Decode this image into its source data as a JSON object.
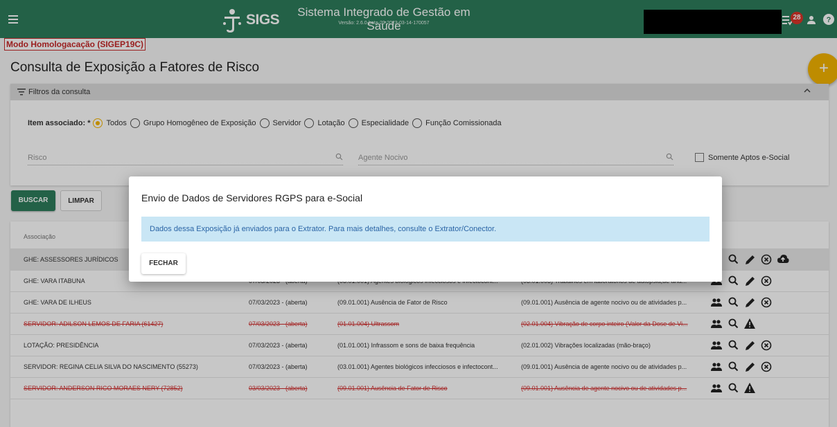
{
  "header": {
    "logo_text": "SIGS",
    "system_title": "Sistema Integrado de Gestão em Saúde",
    "version": "Versão: 2.6.0-beta-20-2023-03-14-170057",
    "notification_count": "28"
  },
  "environment_label": "Modo Homologacação (SIGEP19C)",
  "page_title": "Consulta de Exposição a Fatores de Risco",
  "fab_label": "+",
  "filters": {
    "title": "Filtros da consulta",
    "item_label": "Item associado: *",
    "options": [
      "Todos",
      "Grupo Homogêneo de Exposição",
      "Servidor",
      "Lotação",
      "Especialidade",
      "Função Comissionada"
    ],
    "selected": "Todos",
    "risco_placeholder": "Risco",
    "agente_placeholder": "Agente Nocivo",
    "checkbox_label": "Somente Aptos e-Social"
  },
  "buttons": {
    "buscar": "BUSCAR",
    "limpar": "LIMPAR"
  },
  "table": {
    "headers": [
      "Associação"
    ],
    "rows": [
      {
        "assoc": "GHE: ASSESSORES JURÍDICOS",
        "date": "",
        "risco": "",
        "agente": "",
        "deleted": false,
        "actions": "edit-cancel-upload"
      },
      {
        "assoc": "GHE: VARA ITABUNA",
        "date": "07/03/2023 - (aberta)",
        "risco": "(03.01.001) Agentes biológicos infecciosos e infectocont...",
        "agente": "(03.01.003) Trabalhos em laboratórios de autópsia,de ana...",
        "deleted": false,
        "actions": "edit-cancel"
      },
      {
        "assoc": "GHE: VARA DE ILHEUS",
        "date": "07/03/2023 - (aberta)",
        "risco": "(09.01.001) Ausência de Fator de Risco",
        "agente": "(09.01.001) Ausência de agente nocivo ou de atividades p...",
        "deleted": false,
        "actions": "edit-cancel"
      },
      {
        "assoc": "SERVIDOR: ADILSON LEMOS DE FARIA (61427)",
        "date": "07/03/2023 - (aberta)",
        "risco": "(01.01.004) Ultrassom",
        "agente": "(02.01.004) Vibração de corpo inteiro (Valor da Dose de Vi...",
        "deleted": true,
        "actions": "warning"
      },
      {
        "assoc": "LOTAÇÃO: PRESIDÊNCIA",
        "date": "07/03/2023 - (aberta)",
        "risco": "(01.01.001) Infrassom e sons de baixa frequência",
        "agente": "(02.01.002) Vibrações localizadas (mão-braço)",
        "deleted": false,
        "actions": "edit-cancel"
      },
      {
        "assoc": "SERVIDOR: REGINA CELIA SILVA DO NASCIMENTO (55273)",
        "date": "07/03/2023 - (aberta)",
        "risco": "(03.01.001) Agentes biológicos infecciosos e infectocont...",
        "agente": "(09.01.001) Ausência de agente nocivo ou de atividades p...",
        "deleted": false,
        "actions": "edit-cancel"
      },
      {
        "assoc": "SERVIDOR: ANDERSON RICO MORAES NERY (72852)",
        "date": "03/03/2023 - (aberta)",
        "risco": "(09.01.001) Ausência de Fator de Risco",
        "agente": "(09.01.001) Ausência de agente nocivo ou de atividades p...",
        "deleted": true,
        "actions": "warning"
      }
    ]
  },
  "dialog": {
    "title": "Envio de Dados de Servidores RGPS para e-Social",
    "message": "Dados dessa Exposição já enviados para o Extrator. Para mais detalhes, consulte o Extrator/Conector.",
    "close_label": "FECHAR"
  },
  "colors": {
    "primary": "#2e7d5b",
    "accent": "#f4b400",
    "danger": "#d32f2f",
    "info_bg": "#c9e6f5",
    "info_text": "#2a64a5"
  }
}
